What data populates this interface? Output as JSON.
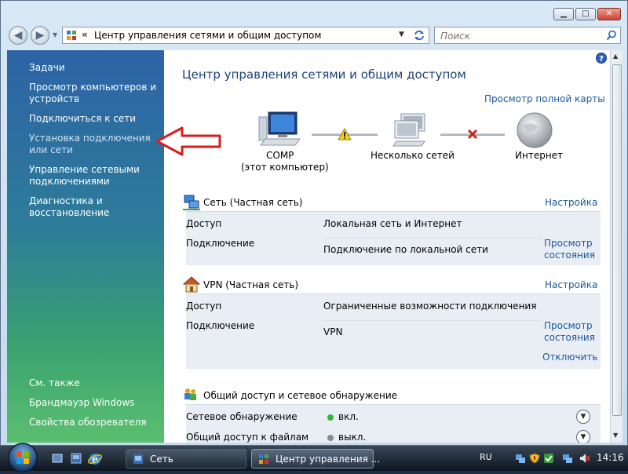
{
  "window": {
    "minimize_glyph": "▁",
    "maximize_glyph": "□",
    "close_glyph": "✕"
  },
  "navbar": {
    "back_glyph": "◀",
    "forward_glyph": "▶",
    "breadcrumb_chevron": "«",
    "path": "Центр управления сетями и общим доступом",
    "search_placeholder": "Поиск"
  },
  "sidebar": {
    "header": "Задачи",
    "tasks": [
      "Просмотр компьютеров и устройств",
      "Подключиться к сети",
      "Установка подключения или сети",
      "Управление сетевыми подключениями",
      "Диагностика и восстановление"
    ],
    "see_also": "См. также",
    "see_also_links": [
      "Брандмауэр Windows",
      "Свойства обозревателя"
    ]
  },
  "main": {
    "title": "Центр управления сетями и общим доступом",
    "full_map_link": "Просмотр полной карты",
    "map": {
      "computer_label": "COMP",
      "computer_sublabel": "(этот компьютер)",
      "middle_label": "Несколько сетей",
      "internet_label": "Интернет"
    },
    "networks": [
      {
        "name": "Сеть (Частная сеть)",
        "customize": "Настройка",
        "access_label": "Доступ",
        "access_value": "Локальная сеть и Интернет",
        "connection_label": "Подключение",
        "connection_value": "Подключение по локальной сети",
        "view_status": [
          "Просмотр",
          "состояния"
        ]
      },
      {
        "name": "VPN (Частная сеть)",
        "customize": "Настройка",
        "access_label": "Доступ",
        "access_value": "Ограниченные возможности подключения",
        "connection_label": "Подключение",
        "connection_value": "VPN",
        "view_status": [
          "Просмотр",
          "состояния"
        ],
        "disconnect": "Отключить"
      }
    ],
    "sharing": {
      "title": "Общий доступ и сетевое обнаружение",
      "rows": [
        {
          "label": "Сетевое обнаружение",
          "value": "вкл.",
          "status_color": "#3cb43c"
        },
        {
          "label": "Общий доступ к файлам",
          "value": "выкл.",
          "status_color": "#8a8a8a"
        }
      ]
    }
  },
  "taskbar": {
    "buttons": [
      "Сеть",
      "Центр управления ..."
    ],
    "language": "RU",
    "clock": "14:16"
  },
  "colors": {
    "link": "#1a5aa0",
    "title": "#1e3f7a",
    "annotation_arrow": "#d42020"
  }
}
